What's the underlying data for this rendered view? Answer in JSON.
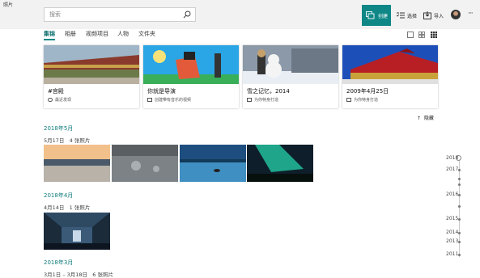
{
  "app": {
    "title": "照片"
  },
  "search": {
    "placeholder": "搜索"
  },
  "toolbar": {
    "create_label": "创建",
    "select_label": "选择",
    "import_label": "导入",
    "more_label": "···"
  },
  "tabs": [
    {
      "label": "集锦",
      "active": true
    },
    {
      "label": "相册",
      "active": false
    },
    {
      "label": "视频项目",
      "active": false
    },
    {
      "label": "人物",
      "active": false
    },
    {
      "label": "文件夹",
      "active": false
    }
  ],
  "cards": [
    {
      "title": "#宫殿",
      "subtitle": "最近发现",
      "icon": "cloud-icon"
    },
    {
      "title": "你就是导演",
      "subtitle": "创建带有音乐的视频",
      "icon": "video-icon"
    },
    {
      "title": "雪之记忆，2014",
      "subtitle": "为你特身打造",
      "icon": "photo-icon"
    },
    {
      "title": "2009年4月25日",
      "subtitle": "为你特身打造",
      "icon": "photo-icon"
    }
  ],
  "hide_label": "隐藏",
  "sections": [
    {
      "month": "2018年5月",
      "date": "5月17日",
      "count": "4 张照片"
    },
    {
      "month": "2018年4月",
      "date": "4月14日",
      "count": "1 张照片"
    },
    {
      "month": "2018年3月",
      "date": "3月1日 – 3月18日",
      "count": "6 张照片"
    }
  ],
  "timeline": {
    "years": [
      "2018",
      "2017",
      "2016",
      "2015",
      "2014",
      "2013",
      "2011"
    ]
  },
  "colors": {
    "accent": "#0f8787"
  }
}
